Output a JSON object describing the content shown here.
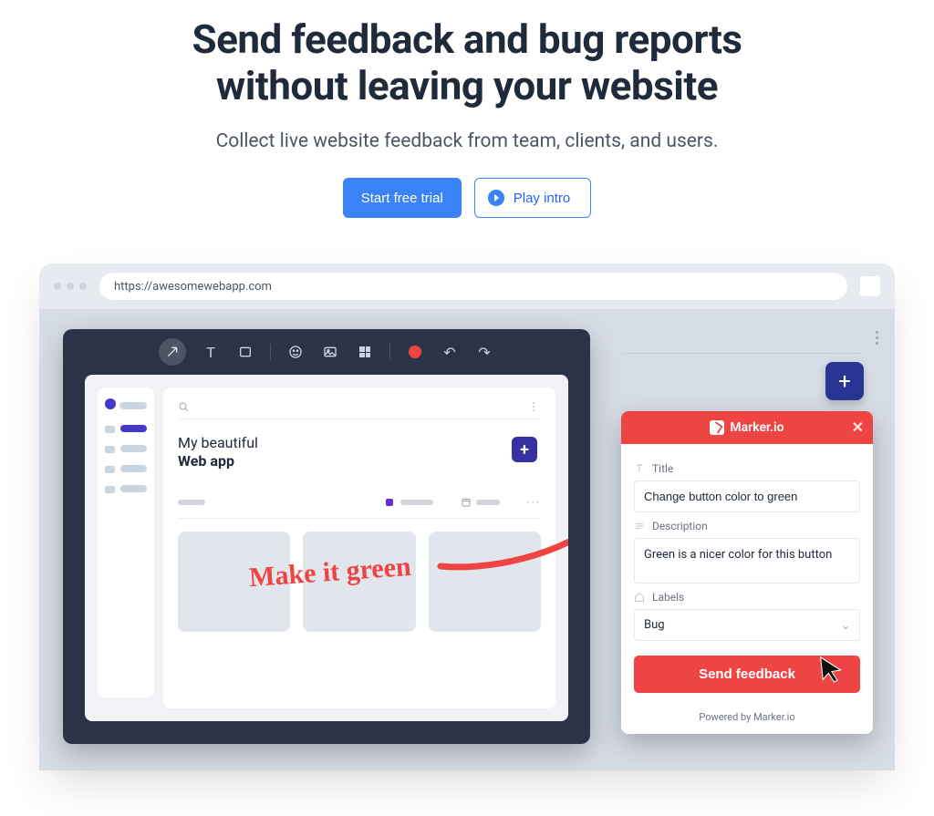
{
  "hero": {
    "title_line1": "Send feedback and bug reports",
    "title_line2": "without leaving your website",
    "subtitle": "Collect live website feedback from team, clients, and users.",
    "cta_primary": "Start free trial",
    "cta_secondary": "Play intro"
  },
  "mockup": {
    "url": "https://awesomewebapp.com",
    "app_title_line1": "My beautiful",
    "app_title_line2": "Web app",
    "annotation_text": "Make it green"
  },
  "widget": {
    "brand": "Marker.io",
    "title_label": "Title",
    "title_value": "Change button color to green",
    "description_label": "Description",
    "description_value": "Green is a nicer color for this button",
    "labels_label": "Labels",
    "labels_value": "Bug",
    "submit": "Send feedback",
    "powered_by": "Powered by Marker.io"
  }
}
